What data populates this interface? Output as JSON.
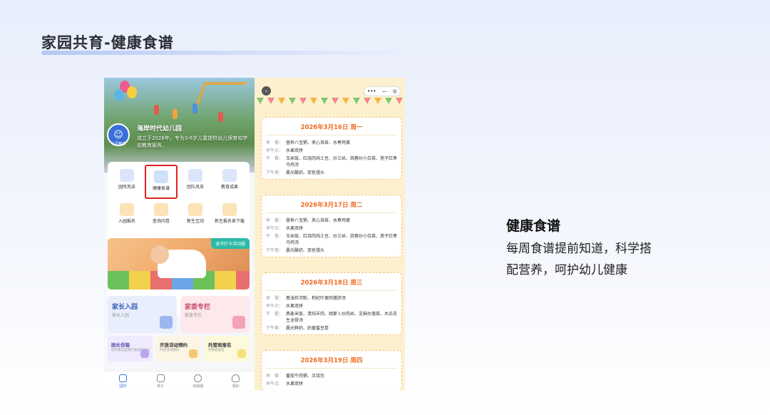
{
  "slide": {
    "title": "家园共育-健康食谱"
  },
  "side": {
    "title": "健康食谱",
    "desc": "每周食谱提前知道，科学搭配营养，呵护幼儿健康"
  },
  "left_phone": {
    "school_name": "海岸时代幼儿园",
    "school_desc": "成立于2026年，专为3-6岁儿童提供幼儿保育和学前教育服务。",
    "logo_label": "小贝精选",
    "grid": [
      {
        "label": "园所风采",
        "icon": "building-icon"
      },
      {
        "label": "健康食谱",
        "icon": "recipe-icon"
      },
      {
        "label": "团队风采",
        "icon": "team-icon"
      },
      {
        "label": "教育成果",
        "icon": "teacher-icon"
      },
      {
        "label": "入园报名",
        "icon": "enroll-icon"
      },
      {
        "label": "查询问卷",
        "icon": "survey-icon"
      },
      {
        "label": "新生互动",
        "icon": "interaction-icon"
      },
      {
        "label": "新生报名表下载",
        "icon": "download-icon"
      }
    ],
    "banner_tag": "读书打卡活动圈",
    "cards": [
      {
        "title": "家长入园",
        "sub": "家长入园"
      },
      {
        "title": "家委专栏",
        "sub": "家委专栏"
      }
    ],
    "small_cards": [
      {
        "title": "园长信箱",
        "sub": "您的建议是我们前进的动力"
      },
      {
        "title": "开放活动预约",
        "sub": "开放活动预约"
      },
      {
        "title": "托管班报名",
        "sub": "托管班报名"
      }
    ],
    "tabs": [
      {
        "label": "园所",
        "icon": "home-icon",
        "active": true
      },
      {
        "label": "孩子",
        "icon": "child-icon",
        "active": false
      },
      {
        "label": "班级圈",
        "icon": "compass-icon",
        "active": false
      },
      {
        "label": "我的",
        "icon": "user-icon",
        "active": false
      }
    ]
  },
  "right_phone": {
    "back": "‹",
    "capsule_menu": "•••",
    "capsule_min": "—",
    "capsule_close": "◎",
    "menus": [
      {
        "date": "2026年3月16日 周一",
        "meals": [
          {
            "k": "早　餐：",
            "v": "营养八宝粥、夹心海苔、水煮鸡蛋"
          },
          {
            "k": "早午点：",
            "v": "水果双拼"
          },
          {
            "k": "午　餐：",
            "v": "玉米饭、红烧肉炖土豆、炒三丝、蒜蓉炒小白菜、莲子红枣乌鸡汤"
          },
          {
            "k": "下午茶：",
            "v": "晨光酸奶、双色馒头"
          }
        ]
      },
      {
        "date": "2026年3月17日 周二",
        "meals": [
          {
            "k": "早　餐：",
            "v": "营养八宝粥、夹心海苔、水煮鸡蛋"
          },
          {
            "k": "早午点：",
            "v": "水果双拼"
          },
          {
            "k": "午　餐：",
            "v": "玉米饭、红烧肉炖土豆、炒三丝、蒜蓉炒小白菜、莲子红枣乌鸡汤"
          },
          {
            "k": "下午茶：",
            "v": "晨光酸奶、双色馒头"
          }
        ]
      },
      {
        "date": "2026年3月18日 周三",
        "meals": [
          {
            "k": "早　餐：",
            "v": "葱油拌河粉、枸杞叶瘦肉猪肝汤"
          },
          {
            "k": "早午点：",
            "v": "水果双拼"
          },
          {
            "k": "午　餐：",
            "v": "燕麦米饭、清炖羊肉、胡萝卜炒肉丝、芝麻炒菠菜、木瓜花生龙骨汤"
          },
          {
            "k": "下午茶：",
            "v": "晨光鲜奶、奶香蜜豆卷"
          }
        ]
      },
      {
        "date": "2026年3月19日 周四",
        "meals": [
          {
            "k": "早　餐：",
            "v": "番茄牛肉粥、叉烧包"
          },
          {
            "k": "早午点：",
            "v": "水果双拼"
          }
        ]
      }
    ]
  }
}
